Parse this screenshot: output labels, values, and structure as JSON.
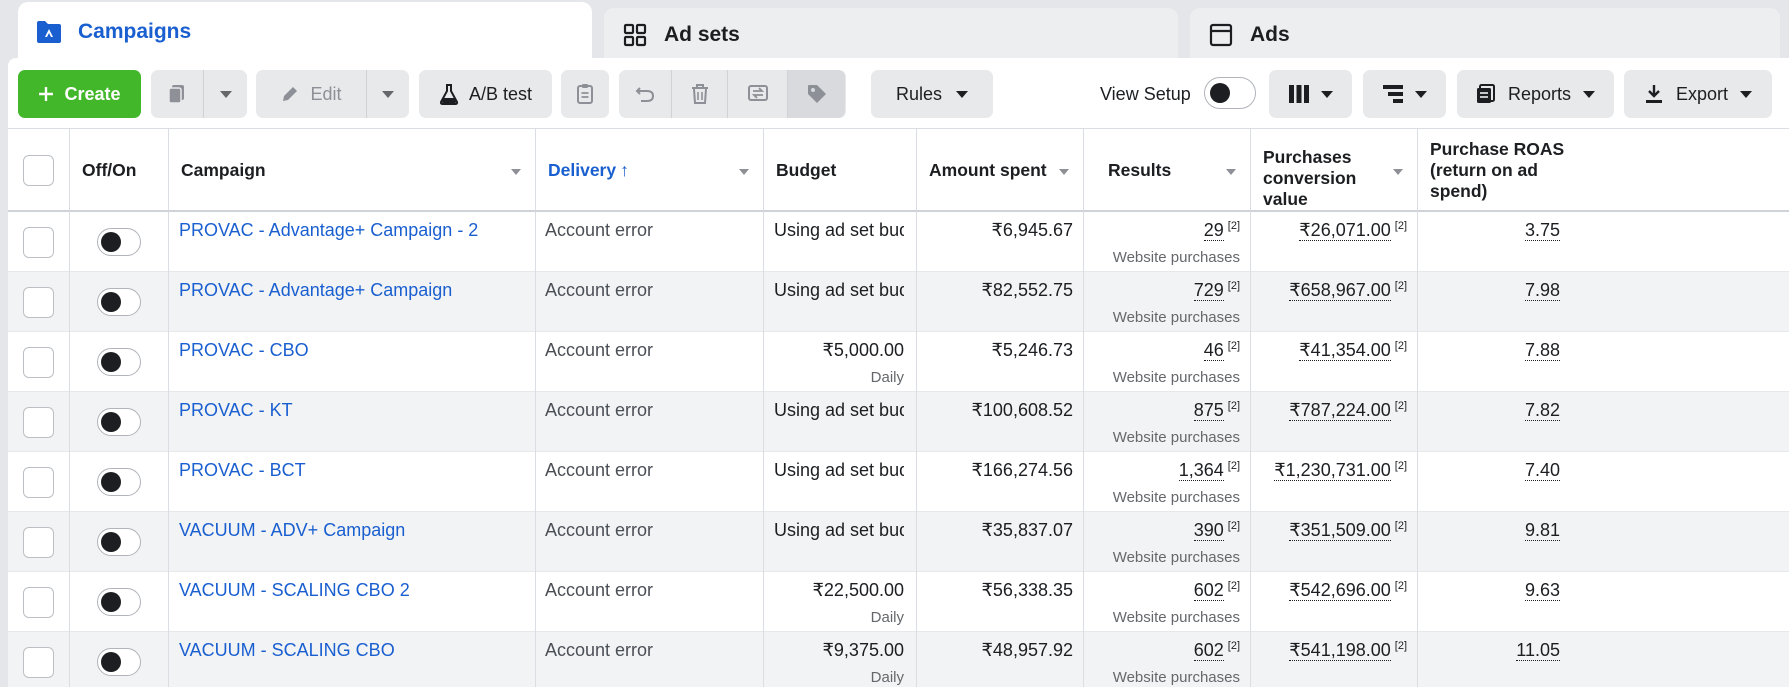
{
  "tabs": [
    {
      "label": "Campaigns",
      "icon": "campaign-folder-icon",
      "active": true
    },
    {
      "label": "Ad sets",
      "icon": "grid-icon",
      "active": false
    },
    {
      "label": "Ads",
      "icon": "ad-window-icon",
      "active": false
    }
  ],
  "toolbar": {
    "create_label": "Create",
    "edit_label": "Edit",
    "ab_test_label": "A/B test",
    "rules_label": "Rules",
    "view_setup_label": "View Setup",
    "reports_label": "Reports",
    "export_label": "Export"
  },
  "columns": {
    "off_on": "Off/On",
    "campaign": "Campaign",
    "delivery": "Delivery",
    "delivery_sort": "↑",
    "budget": "Budget",
    "amount_spent": "Amount spent",
    "results": "Results",
    "purchases_value": "Purchases conversion value",
    "roas": "Purchase ROAS (return on ad spend)"
  },
  "rows": [
    {
      "campaign": "PROVAC - Advantage+ Campaign - 2",
      "delivery": "Account error",
      "budget": "Using ad set bud…",
      "budget_sub": "",
      "spent": "₹6,945.67",
      "results": "29",
      "results_note": "[2]",
      "results_sub": "Website purchases",
      "pcv": "₹26,071.00",
      "pcv_note": "[2]",
      "roas": "3.75"
    },
    {
      "campaign": "PROVAC - Advantage+ Campaign",
      "delivery": "Account error",
      "budget": "Using ad set bud…",
      "budget_sub": "",
      "spent": "₹82,552.75",
      "results": "729",
      "results_note": "[2]",
      "results_sub": "Website purchases",
      "pcv": "₹658,967.00",
      "pcv_note": "[2]",
      "roas": "7.98"
    },
    {
      "campaign": "PROVAC - CBO",
      "delivery": "Account error",
      "budget": "₹5,000.00",
      "budget_sub": "Daily",
      "spent": "₹5,246.73",
      "results": "46",
      "results_note": "[2]",
      "results_sub": "Website purchases",
      "pcv": "₹41,354.00",
      "pcv_note": "[2]",
      "roas": "7.88"
    },
    {
      "campaign": "PROVAC - KT",
      "delivery": "Account error",
      "budget": "Using ad set bud…",
      "budget_sub": "",
      "spent": "₹100,608.52",
      "results": "875",
      "results_note": "[2]",
      "results_sub": "Website purchases",
      "pcv": "₹787,224.00",
      "pcv_note": "[2]",
      "roas": "7.82"
    },
    {
      "campaign": "PROVAC - BCT",
      "delivery": "Account error",
      "budget": "Using ad set bud…",
      "budget_sub": "",
      "spent": "₹166,274.56",
      "results": "1,364",
      "results_note": "[2]",
      "results_sub": "Website purchases",
      "pcv": "₹1,230,731.00",
      "pcv_note": "[2]",
      "roas": "7.40"
    },
    {
      "campaign": "VACUUM - ADV+ Campaign",
      "delivery": "Account error",
      "budget": "Using ad set bud…",
      "budget_sub": "",
      "spent": "₹35,837.07",
      "results": "390",
      "results_note": "[2]",
      "results_sub": "Website purchases",
      "pcv": "₹351,509.00",
      "pcv_note": "[2]",
      "roas": "9.81"
    },
    {
      "campaign": "VACUUM - SCALING CBO 2",
      "delivery": "Account error",
      "budget": "₹22,500.00",
      "budget_sub": "Daily",
      "spent": "₹56,338.35",
      "results": "602",
      "results_note": "[2]",
      "results_sub": "Website purchases",
      "pcv": "₹542,696.00",
      "pcv_note": "[2]",
      "roas": "9.63"
    },
    {
      "campaign": "VACUUM - SCALING CBO",
      "delivery": "Account error",
      "budget": "₹9,375.00",
      "budget_sub": "Daily",
      "spent": "₹48,957.92",
      "results": "602",
      "results_note": "[2]",
      "results_sub": "Website purchases",
      "pcv": "₹541,198.00",
      "pcv_note": "[2]",
      "roas": "11.05"
    }
  ],
  "colors": {
    "accent_blue": "#1a5fd0",
    "create_green": "#42b72a"
  }
}
